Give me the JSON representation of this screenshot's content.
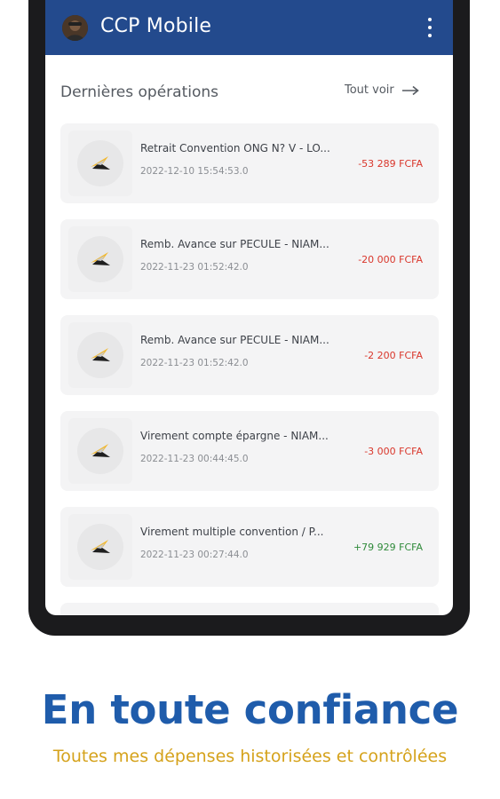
{
  "app": {
    "title": "CCP Mobile",
    "avatar_icon": "user-avatar",
    "menu_icon": "more-vert-icon"
  },
  "section": {
    "title": "Dernières opérations",
    "see_all_label": "Tout voir",
    "see_all_icon": "arrow-right-icon"
  },
  "transactions": [
    {
      "label": "Retrait Convention ONG N? V - LO...",
      "date": "2022-12-10 15:54:53.0",
      "amount": "-53 289 FCFA",
      "direction": "debit",
      "icon": "logo-icon"
    },
    {
      "label": "Remb. Avance sur PECULE - NIAM...",
      "date": "2022-11-23 01:52:42.0",
      "amount": "-20 000 FCFA",
      "direction": "debit",
      "icon": "logo-icon"
    },
    {
      "label": "Remb. Avance sur PECULE - NIAM...",
      "date": "2022-11-23 01:52:42.0",
      "amount": "-2 200 FCFA",
      "direction": "debit",
      "icon": "logo-icon"
    },
    {
      "label": "Virement compte épargne - NIAM...",
      "date": "2022-11-23 00:44:45.0",
      "amount": "-3 000 FCFA",
      "direction": "debit",
      "icon": "logo-icon"
    },
    {
      "label": "Virement multiple convention  / P...",
      "date": "2022-11-23 00:27:44.0",
      "amount": "+79 929 FCFA",
      "direction": "credit",
      "icon": "logo-icon"
    }
  ],
  "marketing": {
    "headline": "En toute confiance",
    "subline": "Toutes mes dépenses historisées et contrôlées"
  },
  "colors": {
    "app_bar": "#234a8d",
    "debit": "#d9362b",
    "credit": "#2f8a3a",
    "headline": "#1f5cab",
    "subline": "#d5a21b",
    "logo_yellow": "#f2b82d"
  }
}
